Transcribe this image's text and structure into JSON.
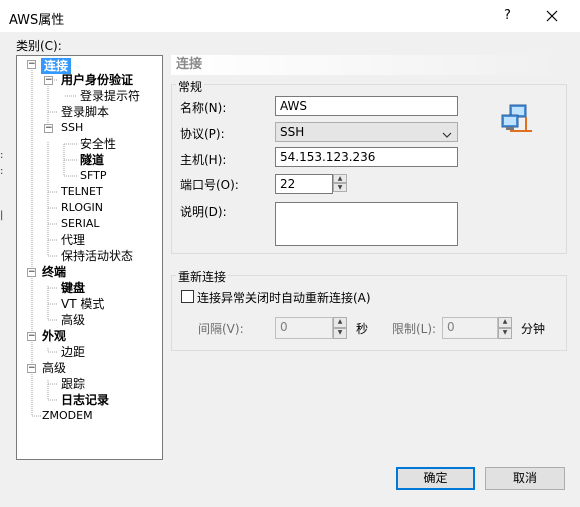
{
  "window": {
    "title": "AWS属性",
    "help": "?",
    "close_icon": "close-icon"
  },
  "category_label": "类别(C):",
  "tree": {
    "items": [
      {
        "label": "连接",
        "selected": true
      },
      {
        "label": "用户身份验证"
      },
      {
        "label": "登录提示符"
      },
      {
        "label": "登录脚本"
      },
      {
        "label": "SSH"
      },
      {
        "label": "安全性"
      },
      {
        "label": "隧道"
      },
      {
        "label": "SFTP"
      },
      {
        "label": "TELNET"
      },
      {
        "label": "RLOGIN"
      },
      {
        "label": "SERIAL"
      },
      {
        "label": "代理"
      },
      {
        "label": "保持活动状态"
      },
      {
        "label": "终端"
      },
      {
        "label": "键盘"
      },
      {
        "label": "VT 模式"
      },
      {
        "label": "高级"
      },
      {
        "label": "外观"
      },
      {
        "label": "边距"
      },
      {
        "label": "高级"
      },
      {
        "label": "跟踪"
      },
      {
        "label": "日志记录"
      },
      {
        "label": "ZMODEM"
      }
    ]
  },
  "panel": {
    "title": "连接",
    "general": {
      "title": "常规",
      "name_label": "名称(N):",
      "name_value": "AWS",
      "protocol_label": "协议(P):",
      "protocol_value": "SSH",
      "host_label": "主机(H):",
      "host_value": "54.153.123.236",
      "port_label": "端口号(O):",
      "port_value": "22",
      "desc_label": "说明(D):",
      "desc_value": ""
    },
    "reconnect": {
      "title": "重新连接",
      "checkbox_label": "连接异常关闭时自动重新连接(A)",
      "checked": false,
      "interval_label": "间隔(V):",
      "interval_value": "0",
      "interval_unit": "秒",
      "limit_label": "限制(L):",
      "limit_value": "0",
      "limit_unit": "分钟"
    }
  },
  "buttons": {
    "ok": "确定",
    "cancel": "取消"
  },
  "colors": {
    "selection": "#3399ff",
    "default_button_border": "#0078d7"
  }
}
